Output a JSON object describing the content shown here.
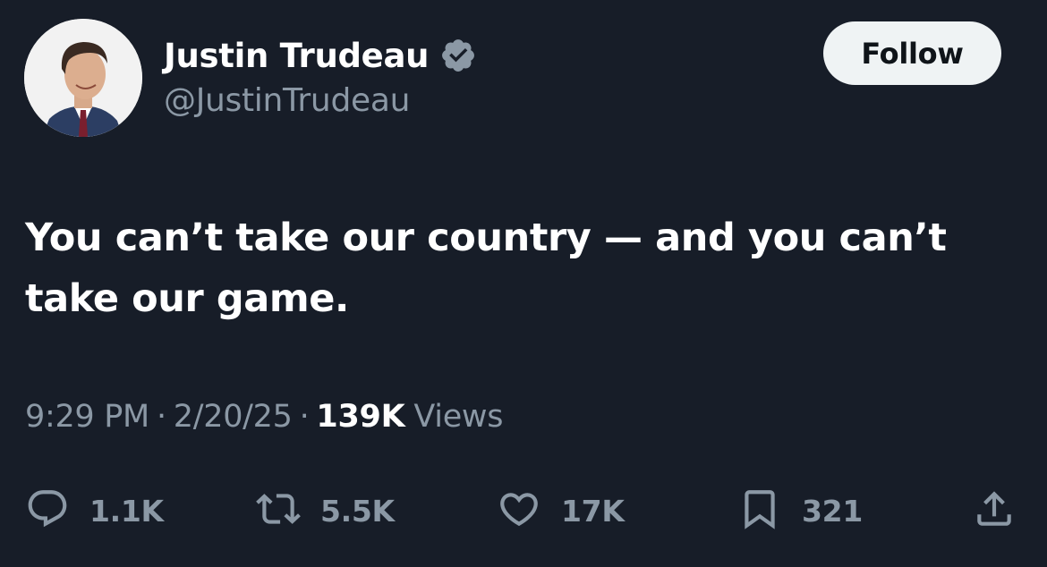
{
  "user": {
    "display_name": "Justin Trudeau",
    "handle": "@JustinTrudeau",
    "verified": true
  },
  "follow_label": "Follow",
  "tweet": {
    "text": "You can’t take our country — and you can’t take our game."
  },
  "meta": {
    "time": "9:29 PM",
    "separator": "·",
    "date": "2/20/25",
    "views_count": "139K",
    "views_label": "Views"
  },
  "actions": {
    "reply_count": "1.1K",
    "retweet_count": "5.5K",
    "like_count": "17K",
    "bookmark_count": "321"
  },
  "icons": {
    "reply": "reply-icon",
    "retweet": "retweet-icon",
    "like": "heart-icon",
    "bookmark": "bookmark-icon",
    "share": "share-icon",
    "verified": "verified-badge-icon"
  },
  "colors": {
    "background": "#171d28",
    "secondary_text": "#8b98a5",
    "follow_bg": "#eff3f4",
    "verified_badge": "#8b98a5"
  }
}
